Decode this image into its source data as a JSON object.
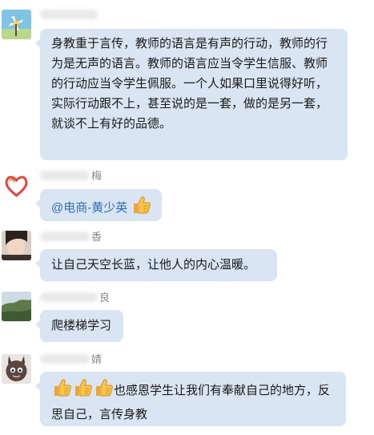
{
  "messages": [
    {
      "name_suffix": "",
      "text": "身教重于言传，教师的语言是有声的行动，教师的行为是无声的语言。教师的语言应当令学生信服、教师的行动应当令学生佩服。一个人如果口里说得好听，实际行动跟不上，甚至说的是一套，做的是另一套，就谈不上有好的品德。"
    },
    {
      "name_suffix": "梅",
      "mention": "@电商-黄少英",
      "emoji": [
        "thumbs-up"
      ]
    },
    {
      "name_suffix": "香",
      "text": "让自己天空长蓝，让他人的内心温暖。"
    },
    {
      "name_suffix": "良",
      "text": "爬楼梯学习"
    },
    {
      "name_suffix": "婧",
      "emoji": [
        "thumbs-up",
        "thumbs-up",
        "thumbs-up"
      ],
      "text": "也感恩学生让我们有奉献自己的地方，反思自己，言传身教"
    }
  ],
  "colors": {
    "bubble": "#d9e5f2",
    "mention": "#2f6fb6",
    "name": "#888888"
  }
}
